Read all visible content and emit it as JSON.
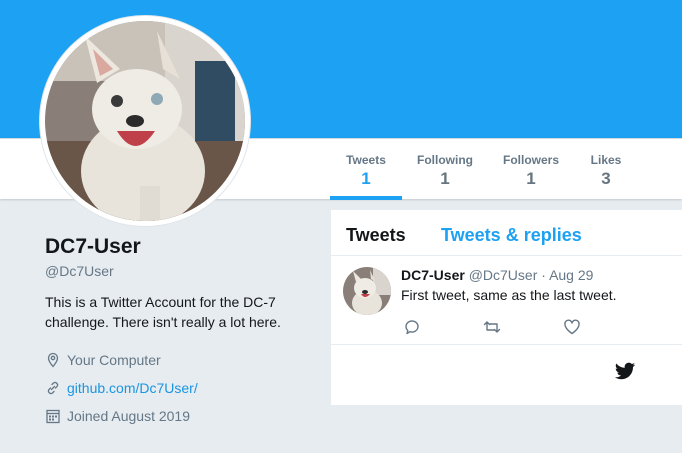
{
  "stats": {
    "tweets": {
      "label": "Tweets",
      "value": "1"
    },
    "following": {
      "label": "Following",
      "value": "1"
    },
    "followers": {
      "label": "Followers",
      "value": "1"
    },
    "likes": {
      "label": "Likes",
      "value": "3"
    }
  },
  "profile": {
    "name": "DC7-User",
    "handle": "@Dc7User",
    "bio": "This is a Twitter Account for the DC-7 challenge. There isn't really a lot here.",
    "location": "Your Computer",
    "website": "github.com/Dc7User/",
    "joined": "Joined August 2019"
  },
  "timeline": {
    "tabs": [
      "Tweets",
      "Tweets & replies"
    ],
    "tweet": {
      "name": "DC7-User",
      "handle": "@Dc7User",
      "dot": "·",
      "date": "Aug 29",
      "text": "First tweet, same as the last tweet."
    }
  },
  "icons": {
    "location": "location-pin-icon",
    "website": "link-icon",
    "joined": "calendar-icon",
    "reply": "reply-icon",
    "retweet": "retweet-icon",
    "like": "heart-icon",
    "brand": "twitter-bird-icon"
  },
  "colors": {
    "brand": "#1da1f2",
    "link": "#1b95e0",
    "muted": "#657786",
    "background": "#e6ecf0"
  }
}
